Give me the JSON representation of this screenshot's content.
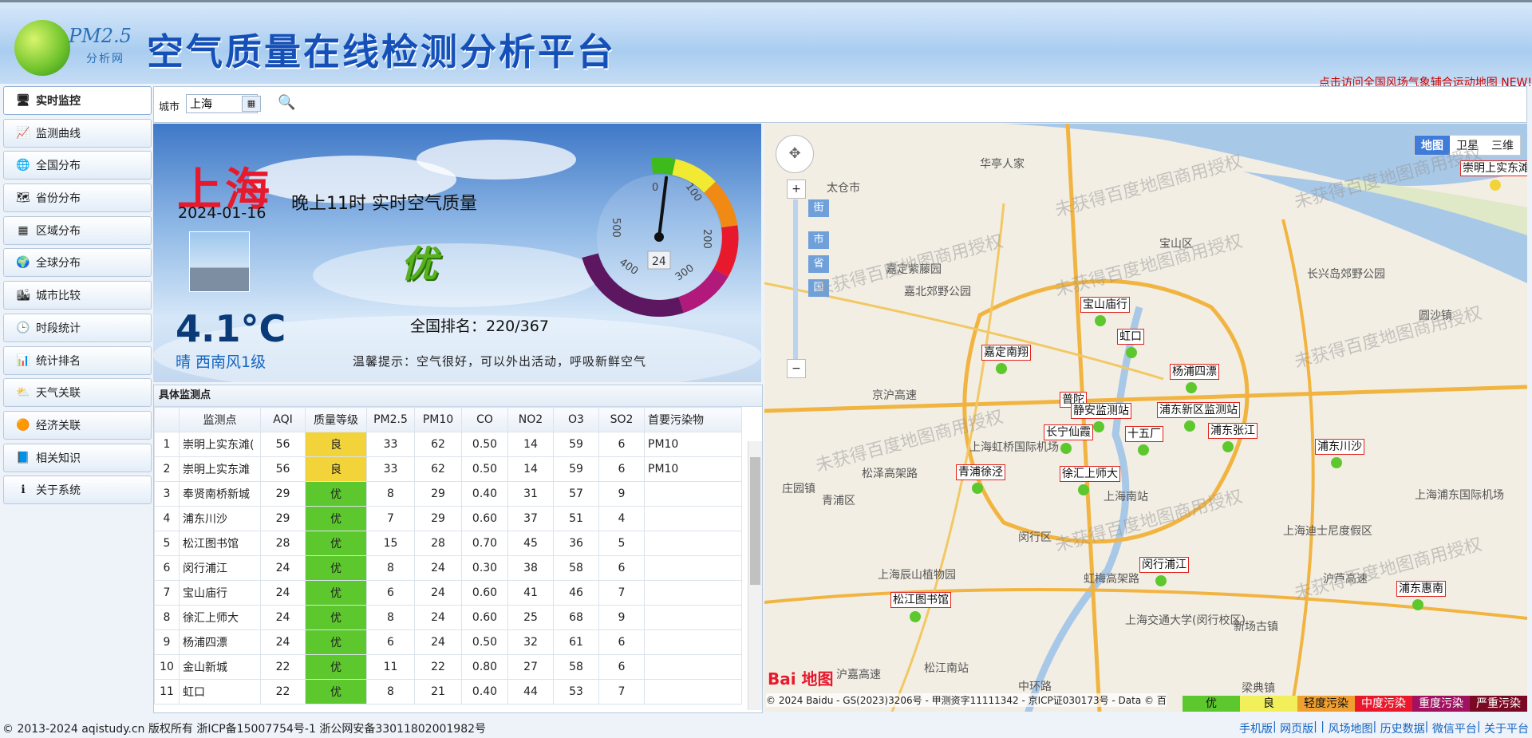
{
  "header": {
    "logo_text": "PM2.5",
    "logo_sub": "分析网",
    "site_title": "空气质量在线检测分析平台",
    "notice": "点击访问全国风场气象辅合运动地图 NEW!"
  },
  "sidebar": {
    "items": [
      {
        "label": "实时监控",
        "icon": "monitor-icon"
      },
      {
        "label": "监测曲线",
        "icon": "curve-icon"
      },
      {
        "label": "全国分布",
        "icon": "globe-icon"
      },
      {
        "label": "省份分布",
        "icon": "province-icon"
      },
      {
        "label": "区域分布",
        "icon": "region-icon"
      },
      {
        "label": "全球分布",
        "icon": "world-icon"
      },
      {
        "label": "城市比较",
        "icon": "city-compare-icon"
      },
      {
        "label": "时段统计",
        "icon": "clock-icon"
      },
      {
        "label": "统计排名",
        "icon": "bar-rank-icon"
      },
      {
        "label": "天气关联",
        "icon": "weather-icon"
      },
      {
        "label": "经济关联",
        "icon": "coin-icon"
      },
      {
        "label": "相关知识",
        "icon": "book-icon"
      },
      {
        "label": "关于系统",
        "icon": "info-icon"
      }
    ]
  },
  "search": {
    "label": "城市",
    "value": "上海"
  },
  "realtime": {
    "city": "上海",
    "date": "2024-01-16",
    "temperature": "4.1°C",
    "wind": "晴 西南风1级",
    "title": "晚上11时 实时空气质量",
    "level": "优",
    "rank": "全国排名：220/367",
    "tip": "温馨提示：空气很好，可以外出活动，呼吸新鲜空气",
    "gauge": {
      "value": "24",
      "aqi": 24,
      "ticks": [
        "0",
        "100",
        "200",
        "300",
        "400",
        "500"
      ]
    }
  },
  "stations": {
    "title": "具体监测点",
    "headers": [
      "",
      "监测点",
      "AQI",
      "质量等级",
      "PM2.5",
      "PM10",
      "CO",
      "NO2",
      "O3",
      "SO2",
      "首要污染物"
    ],
    "rows": [
      [
        "1",
        "崇明上实东滩(",
        "56",
        "良",
        "33",
        "62",
        "0.50",
        "14",
        "59",
        "6",
        "PM10"
      ],
      [
        "2",
        "崇明上实东滩",
        "56",
        "良",
        "33",
        "62",
        "0.50",
        "14",
        "59",
        "6",
        "PM10"
      ],
      [
        "3",
        "奉贤南桥新城",
        "29",
        "优",
        "8",
        "29",
        "0.40",
        "31",
        "57",
        "9",
        ""
      ],
      [
        "4",
        "浦东川沙",
        "29",
        "优",
        "7",
        "29",
        "0.60",
        "37",
        "51",
        "4",
        ""
      ],
      [
        "5",
        "松江图书馆",
        "28",
        "优",
        "15",
        "28",
        "0.70",
        "45",
        "36",
        "5",
        ""
      ],
      [
        "6",
        "闵行浦江",
        "24",
        "优",
        "8",
        "24",
        "0.30",
        "38",
        "58",
        "6",
        ""
      ],
      [
        "7",
        "宝山庙行",
        "24",
        "优",
        "6",
        "24",
        "0.60",
        "41",
        "46",
        "7",
        ""
      ],
      [
        "8",
        "徐汇上师大",
        "24",
        "优",
        "8",
        "24",
        "0.60",
        "25",
        "68",
        "9",
        ""
      ],
      [
        "9",
        "杨浦四漂",
        "24",
        "优",
        "6",
        "24",
        "0.50",
        "32",
        "61",
        "6",
        ""
      ],
      [
        "10",
        "金山新城",
        "22",
        "优",
        "11",
        "22",
        "0.80",
        "27",
        "58",
        "6",
        ""
      ],
      [
        "11",
        "虹口",
        "22",
        "优",
        "8",
        "21",
        "0.40",
        "44",
        "53",
        "7",
        ""
      ]
    ]
  },
  "map": {
    "types": [
      "地图",
      "卫星",
      "三维"
    ],
    "zoom_labels": [
      "街",
      "市",
      "省",
      "国"
    ],
    "station_labels": [
      "崇明上实东滩",
      "宝山庙行",
      "虹口",
      "嘉定南翔",
      "杨浦四漂",
      "普陀",
      "静安监测站",
      "浦东新区监测站",
      "长宁仙霞",
      "十五厂",
      "浦东张江",
      "浦东川沙",
      "徐汇上师大",
      "青浦徐泾",
      "闵行浦江",
      "松江图书馆",
      "浦东惠南"
    ],
    "places": [
      "华亭人家",
      "太仓市",
      "宝山区",
      "长兴岛郊野公园",
      "嘉定紫藤园",
      "嘉北郊野公园",
      "京沪高速",
      "松泽高架路",
      "青浦区",
      "上海虹桥国际机场",
      "上海南站",
      "闵行区",
      "上海辰山植物园",
      "上海迪士尼度假区",
      "上海浦东国际机场",
      "庄园镇",
      "圆沙镇",
      "上海交通大学(闵行校区)",
      "新场古镇",
      "松江南站",
      "沪嘉高速",
      "中环路",
      "虹梅高架路",
      "沪芦高速",
      "梁典镇"
    ],
    "watermark": "未获得百度地图商用授权",
    "legend": [
      {
        "label": "优",
        "color": "#5cc82d",
        "text": "#111"
      },
      {
        "label": "良",
        "color": "#f2f05a",
        "text": "#111"
      },
      {
        "label": "轻度污染",
        "color": "#f0a030",
        "text": "#111"
      },
      {
        "label": "中度污染",
        "color": "#e8192c",
        "text": "#fff"
      },
      {
        "label": "重度污染",
        "color": "#a0125f",
        "text": "#fff"
      },
      {
        "label": "严重污染",
        "color": "#7a0a23",
        "text": "#fff"
      }
    ],
    "copyright": "© 2024 Baidu - GS(2023)3206号 - 甲测资字11111342 - 京ICP证030173号 - Data © 百",
    "brand": "Bai 地图"
  },
  "footer": {
    "left": "© 2013-2024 aqistudy.cn 版权所有 浙ICP备15007754号-1 浙公网安备33011802001982号",
    "links": [
      "手机版",
      "网页版",
      "风场地图",
      "历史数据",
      "微信平台",
      "关于平台"
    ]
  },
  "colors": {
    "good": "#f2d33a",
    "excellent": "#5cc82d",
    "brand_blue": "#1550b8",
    "city_red": "#e8192c"
  }
}
